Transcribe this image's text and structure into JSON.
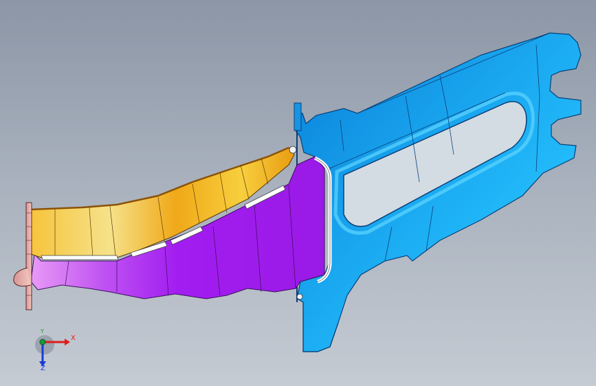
{
  "triad": {
    "x_label": "X",
    "y_label": "Y",
    "z_label": "Z"
  },
  "colors": {
    "background_top": "#8c96a6",
    "background_bottom": "#c5cbd3",
    "bracket_blue": "#1aa0ea",
    "upper_orange": "#f3ae19",
    "lower_purple": "#a21df0",
    "flange_pink": "#e9b1ad",
    "axis_x": "#e01b1b",
    "axis_y": "#1a9a3a",
    "axis_z": "#1b3ad9"
  }
}
